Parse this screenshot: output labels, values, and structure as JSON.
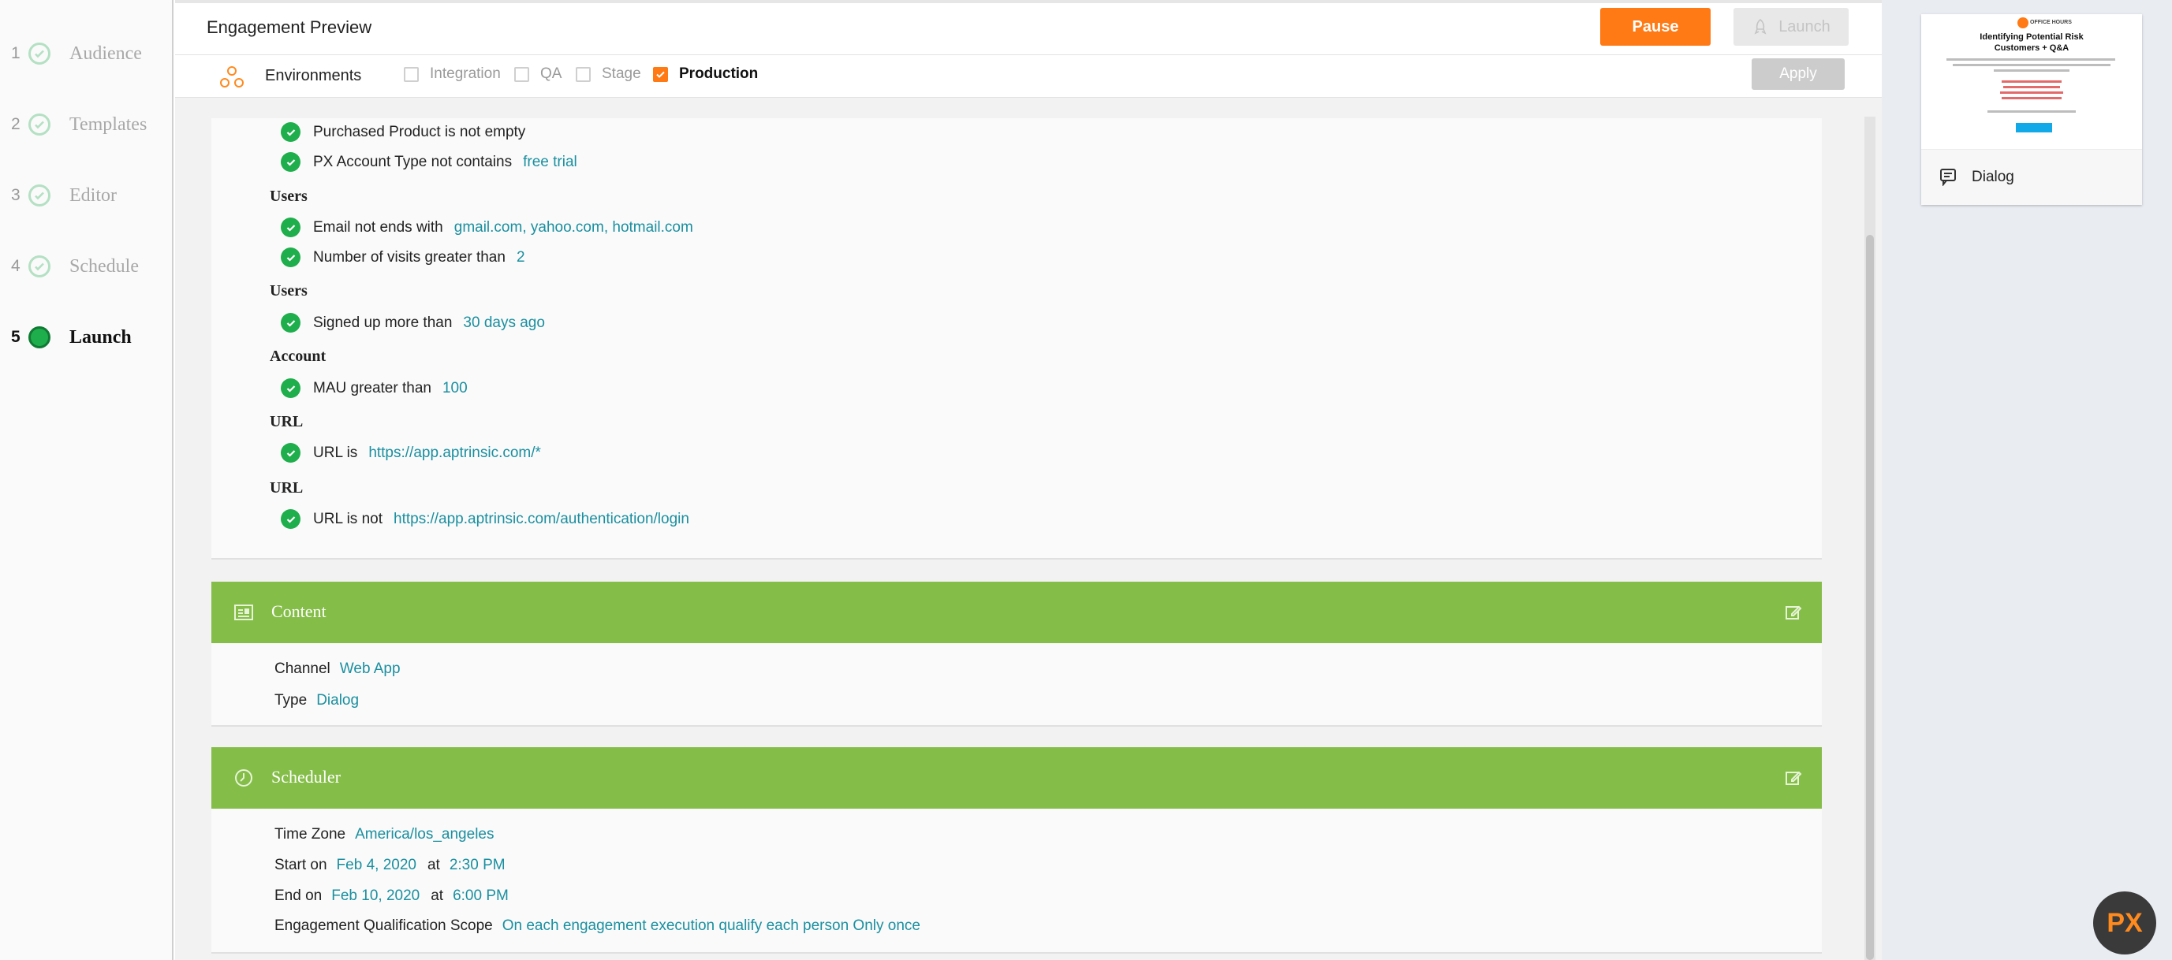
{
  "steps": [
    {
      "num": "1",
      "label": "Audience"
    },
    {
      "num": "2",
      "label": "Templates"
    },
    {
      "num": "3",
      "label": "Editor"
    },
    {
      "num": "4",
      "label": "Schedule"
    },
    {
      "num": "5",
      "label": "Launch"
    }
  ],
  "header": {
    "title": "Engagement Preview",
    "pause_label": "Pause",
    "launch_label": "Launch"
  },
  "environments": {
    "label": "Environments",
    "options": [
      {
        "label": "Integration",
        "checked": false
      },
      {
        "label": "QA",
        "checked": false
      },
      {
        "label": "Stage",
        "checked": false
      },
      {
        "label": "Production",
        "checked": true
      }
    ],
    "apply_label": "Apply"
  },
  "audience_rules": {
    "top": [
      {
        "text": "Purchased Product is not empty",
        "value": ""
      },
      {
        "text": "PX Account Type not contains",
        "value": "free trial"
      }
    ],
    "groups": [
      {
        "title": "Users",
        "rules": [
          {
            "text": "Email not ends with",
            "value": "gmail.com, yahoo.com, hotmail.com"
          },
          {
            "text": "Number of visits greater than",
            "value": "2"
          }
        ]
      },
      {
        "title": "Users",
        "rules": [
          {
            "text": "Signed up more than",
            "value": "30 days ago"
          }
        ]
      },
      {
        "title": "Account",
        "rules": [
          {
            "text": "MAU greater than",
            "value": "100"
          }
        ]
      },
      {
        "title": "URL",
        "rules": [
          {
            "text": "URL is",
            "value": "https://app.aptrinsic.com/*"
          }
        ]
      },
      {
        "title": "URL",
        "rules": [
          {
            "text": "URL is not",
            "value": "https://app.aptrinsic.com/authentication/login"
          }
        ]
      }
    ]
  },
  "content": {
    "title": "Content",
    "channel_label": "Channel",
    "channel_value": "Web App",
    "type_label": "Type",
    "type_value": "Dialog"
  },
  "scheduler": {
    "title": "Scheduler",
    "timezone_label": "Time Zone",
    "timezone_value": "America/los_angeles",
    "start_label": "Start on",
    "start_date": "Feb 4, 2020",
    "at_label": "at",
    "start_time": "2:30 PM",
    "end_label": "End on",
    "end_date": "Feb 10, 2020",
    "end_time": "6:00 PM",
    "scope_label": "Engagement Qualification Scope",
    "scope_value": "On each engagement execution qualify each person Only once"
  },
  "preview": {
    "brand": "OFFICE HOURS",
    "title_line1": "Identifying Potential Risk",
    "title_line2": "Customers + Q&A",
    "label": "Dialog"
  },
  "badge": "PX",
  "colors": {
    "accent_orange": "#ff7a14",
    "section_green": "#84bd48",
    "check_green": "#1fae4c",
    "value_teal": "#1a8fa0"
  }
}
